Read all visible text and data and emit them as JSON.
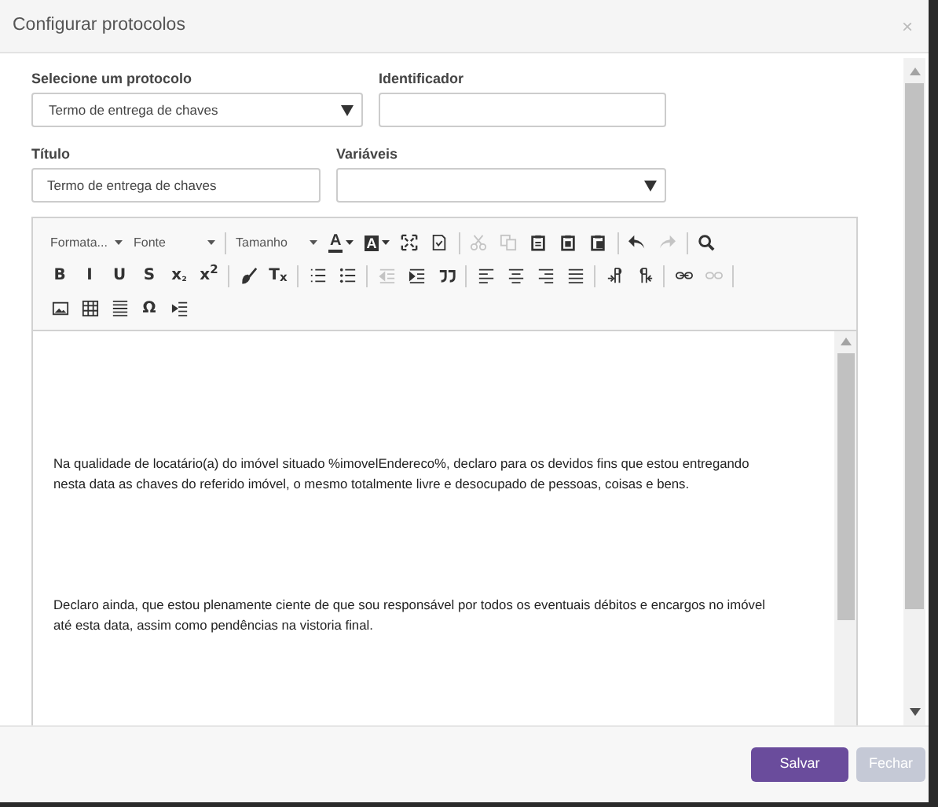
{
  "window": {
    "title": "Configurar protocolos",
    "close": "×"
  },
  "form": {
    "protocol": {
      "label": "Selecione um protocolo",
      "value": "Termo de entrega de chaves"
    },
    "identifier": {
      "label": "Identificador"
    },
    "title": {
      "label": "Título",
      "value": "Termo de entrega de chaves"
    },
    "variables": {
      "label": "Variáveis"
    }
  },
  "toolbar": {
    "rows": [
      {
        "groups": [
          [
            {
              "kind": "combo",
              "label": "Formata..."
            },
            {
              "kind": "combo",
              "label": "Fonte"
            }
          ],
          [
            {
              "kind": "combo",
              "label": "Tamanho"
            },
            {
              "kind": "color",
              "label": "A",
              "disabled": false
            },
            {
              "kind": "bgcolor",
              "label": "A",
              "disabled": false
            },
            {
              "kind": "icon",
              "disabled": false
            },
            {
              "kind": "icon",
              "disabled": false
            }
          ],
          [
            {
              "kind": "icon",
              "disabled": true
            },
            {
              "kind": "icon",
              "disabled": true
            },
            {
              "kind": "icon",
              "disabled": false
            },
            {
              "kind": "icon",
              "disabled": false
            },
            {
              "kind": "icon",
              "disabled": false
            }
          ],
          [
            {
              "kind": "icon",
              "disabled": false
            },
            {
              "kind": "icon",
              "disabled": true
            }
          ],
          [
            {
              "kind": "icon",
              "disabled": false
            }
          ]
        ]
      },
      {
        "groups": [
          [
            {
              "kind": "glyph",
              "label": "B",
              "disabled": false
            },
            {
              "kind": "glyph",
              "label": "I",
              "disabled": false
            },
            {
              "kind": "glyph",
              "label": "U",
              "disabled": false
            },
            {
              "kind": "glyph",
              "label": "S",
              "disabled": false
            },
            {
              "kind": "glyph",
              "label": "x$_{₂}$",
              "disabled": false
            },
            {
              "kind": "glyph",
              "label": "x$^{2}$",
              "disabled": false
            }
          ],
          [
            {
              "kind": "icon",
              "disabled": false
            },
            {
              "kind": "glyph",
              "label": "T$_{x}$",
              "disabled": false
            }
          ],
          [
            {
              "kind": "icon",
              "disabled": false
            },
            {
              "kind": "icon",
              "disabled": false
            }
          ],
          [
            {
              "kind": "icon",
              "disabled": true
            },
            {
              "kind": "icon",
              "disabled": false
            },
            {
              "kind": "icon",
              "disabled": false
            }
          ],
          [
            {
              "kind": "icon",
              "disabled": false
            },
            {
              "kind": "icon",
              "disabled": false
            },
            {
              "kind": "icon",
              "disabled": false
            },
            {
              "kind": "icon",
              "disabled": false
            }
          ],
          [
            {
              "kind": "icon",
              "disabled": false
            },
            {
              "kind": "icon",
              "disabled": false
            }
          ],
          [
            {
              "kind": "icon",
              "disabled": false
            },
            {
              "kind": "icon",
              "disabled": true
            }
          ]
        ]
      },
      {
        "groups": [
          [
            {
              "kind": "icon",
              "disabled": false
            },
            {
              "kind": "icon",
              "disabled": false
            },
            {
              "kind": "icon",
              "disabled": false
            },
            {
              "kind": "glyph",
              "label": "Ω",
              "disabled": false
            },
            {
              "kind": "icon",
              "disabled": false
            }
          ]
        ]
      }
    ]
  },
  "editor": {
    "paragraphs": [
      "Na qualidade de locatário(a) do imóvel situado %imovelEndereco%, declaro para os devidos fins que estou entregando nesta data as chaves do referido imóvel, o mesmo totalmente livre e desocupado de pessoas, coisas e bens.",
      "Declaro ainda, que estou plenamente ciente de que sou responsável por todos os eventuais débitos e encargos no imóvel até esta data, assim como pendências na vistoria final."
    ]
  },
  "buttons": [
    {
      "kind": "primary",
      "label": "Salvar",
      "disabled": false
    },
    {
      "kind": "secondary",
      "label": "Fechar",
      "disabled": true
    }
  ]
}
